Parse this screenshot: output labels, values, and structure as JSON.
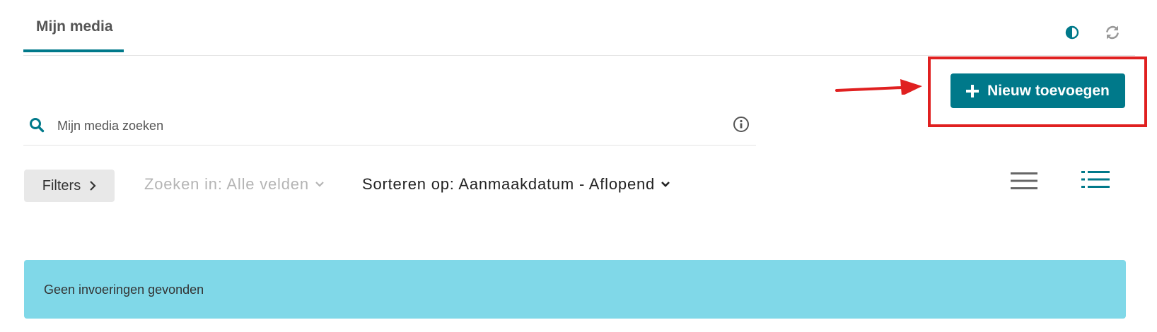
{
  "tabs": [
    {
      "label": "Mijn media",
      "active": true
    }
  ],
  "toolbar": {
    "contrast_icon": "contrast-icon",
    "refresh_icon": "refresh-icon"
  },
  "add_button": {
    "icon": "plus-icon",
    "label": "Nieuw toevoegen"
  },
  "search": {
    "placeholder": "Mijn media zoeken",
    "value": "",
    "icon": "search-icon",
    "info_icon": "info-icon"
  },
  "filters": {
    "button_label": "Filters",
    "search_in": "Zoeken in: Alle velden",
    "sort_by": "Sorteren op: Aanmaakdatum - Aflopend"
  },
  "view_modes": [
    {
      "name": "list",
      "icon": "hamburger-list-icon",
      "active": false
    },
    {
      "name": "detailed",
      "icon": "bulleted-list-icon",
      "active": true
    }
  ],
  "empty_state": {
    "message": "Geen invoeringen gevonden"
  },
  "colors": {
    "accent": "#00798a",
    "alert_bg": "#80d8e8",
    "annotation": "#e02020"
  }
}
